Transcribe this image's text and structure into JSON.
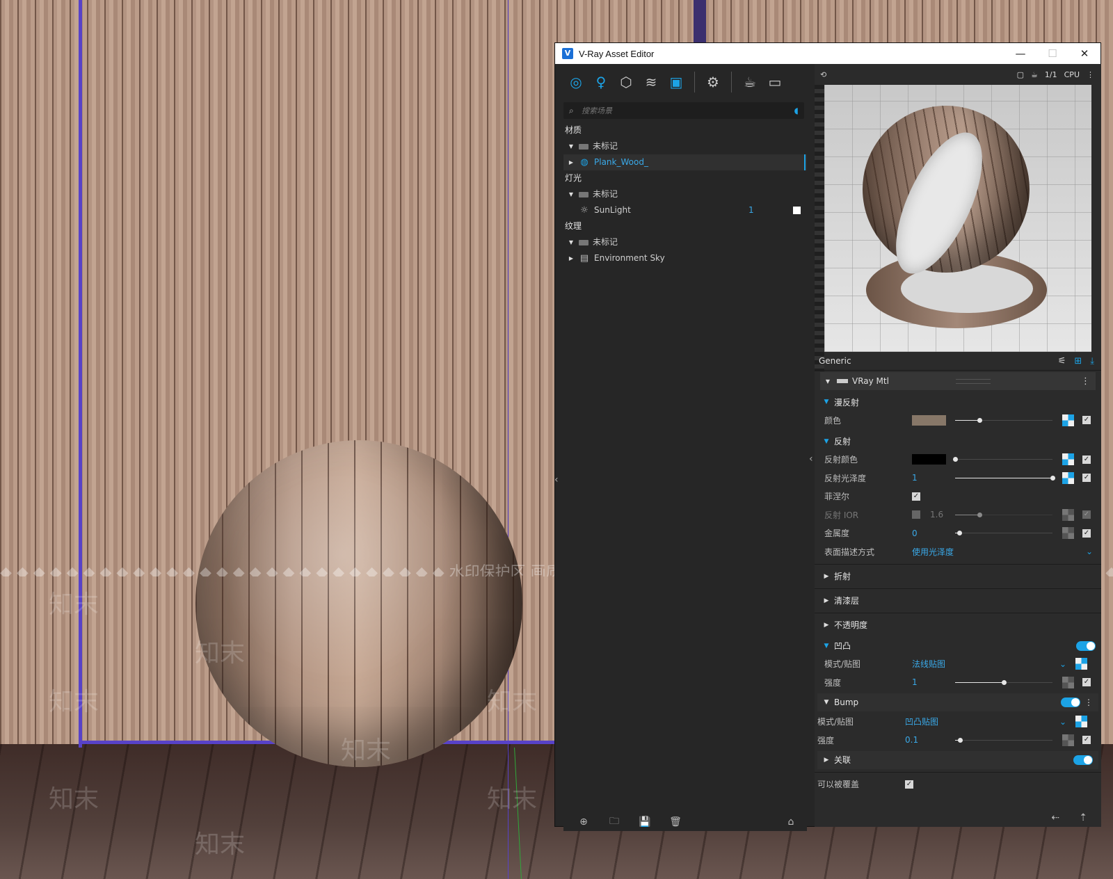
{
  "viewport": {
    "watermark_line": "◆ ◆ ◆ ◆ ◆ ◆ ◆ ◆ ◆ ◆ ◆ ◆ ◆ ◆ ◆ ◆ ◆ ◆ ◆ ◆ ◆ ◆ ◆ ◆ ◆ ◆ ◆ 水印保护区  画质会受到部分影响 ◆ ◆ ◆ ◆ ◆ ◆ ◆ ◆ ◆ ◆ ◆ ◆ ◆ ◆ ◆ ◆ ◆ ◆ ◆ ◆ ◆ ◆ ◆ ◆ ◆ ◆ ◆ ◆",
    "watermark_text": "知末"
  },
  "window": {
    "title": "V-Ray Asset Editor",
    "app_icon": "V",
    "minimize": "—",
    "maximize": "☐",
    "close": "✕"
  },
  "toolbar": {
    "icons": [
      "materials-icon",
      "lights-icon",
      "geometry-icon",
      "layers-icon",
      "textures-icon",
      "settings-icon",
      "teapot-render-icon",
      "frame-buffer-icon"
    ]
  },
  "search": {
    "placeholder": "搜索场景"
  },
  "tree": {
    "materials_label": "材质",
    "materials_untagged": "未标记",
    "material_item": "Plank_Wood_",
    "lights_label": "灯光",
    "lights_untagged": "未标记",
    "light_item": "SunLight",
    "light_count": "1",
    "textures_label": "纹理",
    "textures_untagged": "未标记",
    "texture_item": "Environment Sky"
  },
  "preview_bar": {
    "ratio": "1/1",
    "engine": "CPU"
  },
  "props": {
    "header": "Generic",
    "material_type": "VRay Mtl",
    "diffuse": {
      "title": "漫反射",
      "color_label": "颜色",
      "color": "#877768",
      "slider_value": 0.25
    },
    "reflection": {
      "title": "反射",
      "color_label": "反射颜色",
      "color": "#000000",
      "color_slider": 0.0,
      "gloss_label": "反射光泽度",
      "gloss_value": "1",
      "fresnel_label": "菲涅尔",
      "ior_label": "反射 IOR",
      "ior_value": "1.6",
      "metal_label": "金属度",
      "metal_value": "0",
      "brdf_label": "表面描述方式",
      "brdf_value": "使用光泽度"
    },
    "refraction_title": "折射",
    "coat_title": "清漆层",
    "opacity_title": "不透明度",
    "bump": {
      "title": "凹凸",
      "mode_label": "模式/贴图",
      "mode_value": "法线贴图",
      "strength_label": "强度",
      "strength_value": "1",
      "strength_slider": 0.5
    },
    "bump2": {
      "title": "Bump",
      "mode_label": "模式/贴图",
      "mode_value": "凹凸贴图",
      "strength_label": "强度",
      "strength_value": "0.1",
      "strength_slider": 0.05
    },
    "binding_title": "关联",
    "overridable_label": "可以被覆盖"
  },
  "colors": {
    "accent": "#1ca3e6",
    "panel": "#262626",
    "frame": "#5842c8"
  }
}
